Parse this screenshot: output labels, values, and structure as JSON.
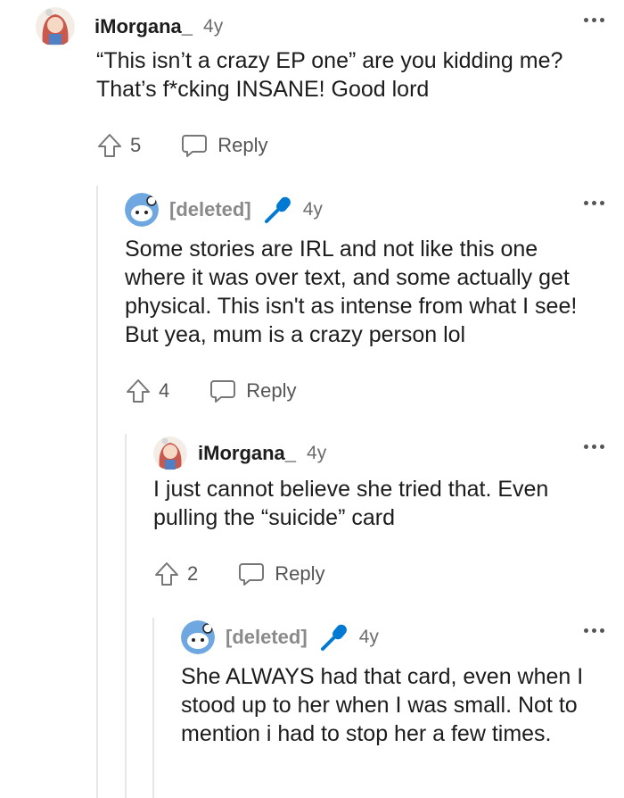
{
  "comments": [
    {
      "user": "iMorgana_",
      "age": "4y",
      "text": "“This isn’t a crazy EP one” are you kidding me? That’s f*cking INSANE! Good lord",
      "votes": "5",
      "reply_label": "Reply"
    },
    {
      "user": "[deleted]",
      "age": "4y",
      "text": "Some stories are IRL and not like this one where it was over text, and some actually get physical. This isn't as intense from what I see! But yea, mum is a crazy person lol",
      "votes": "4",
      "reply_label": "Reply"
    },
    {
      "user": "iMorgana_",
      "age": "4y",
      "text": "I just cannot believe she tried that. Even pulling the “suicide” card",
      "votes": "2",
      "reply_label": "Reply"
    },
    {
      "user": "[deleted]",
      "age": "4y",
      "text": "She ALWAYS had that card, even when I stood up to her when I was small. Not to mention i had to stop her a few times."
    }
  ],
  "colors": {
    "accent": "#0079d3",
    "text": "#1c1c1c",
    "muted": "#6d6d6d"
  },
  "icons": [
    "avatar",
    "microphone-icon",
    "upvote-icon",
    "reply-bubble-icon",
    "more-options-icon"
  ]
}
